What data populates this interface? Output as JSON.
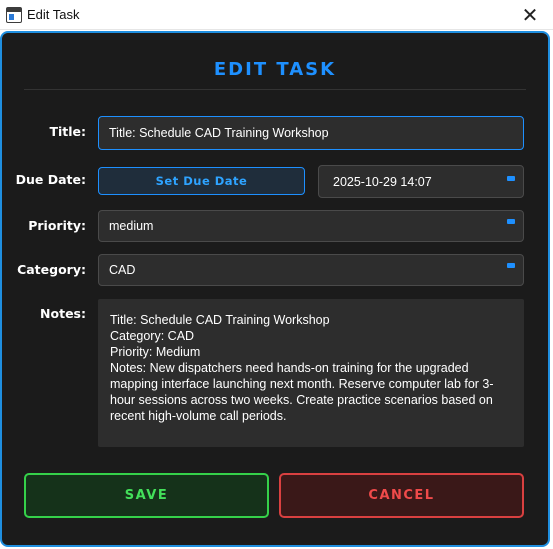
{
  "window": {
    "title": "Edit Task",
    "close_glyph": "✕"
  },
  "dialog": {
    "heading": "EDIT TASK"
  },
  "form": {
    "title_label": "Title:",
    "title_value": "Title: Schedule CAD Training Workshop",
    "due_label": "Due Date:",
    "due_button": "Set Due Date",
    "due_value": "2025-10-29 14:07",
    "priority_label": "Priority:",
    "priority_value": "medium",
    "category_label": "Category:",
    "category_value": "CAD",
    "notes_label": "Notes:",
    "notes_value": "Title: Schedule CAD Training Workshop\nCategory: CAD\nPriority: Medium\nNotes: New dispatchers need hands-on training for the upgraded mapping interface launching next month. Reserve computer lab for 3-hour sessions across two weeks. Create practice scenarios based on recent high-volume call periods."
  },
  "actions": {
    "save_label": "SAVE",
    "cancel_label": "CANCEL"
  },
  "colors": {
    "accent": "#1e90ff",
    "save": "#43e05a",
    "cancel": "#ef4a4a",
    "background": "#1b1b1b"
  }
}
